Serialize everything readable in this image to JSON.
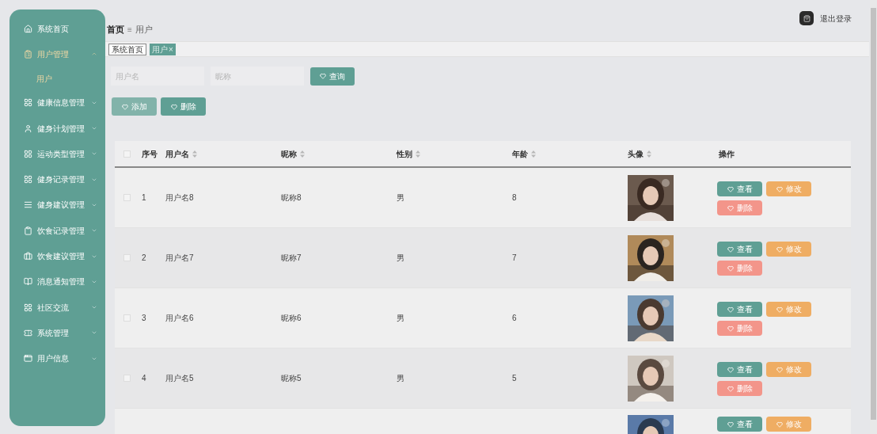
{
  "sidebar": {
    "items": [
      {
        "label": "系统首页",
        "selected": false
      },
      {
        "label": "用户管理",
        "selected": true,
        "expanded": true,
        "children": [
          {
            "label": "用户",
            "selected": true
          }
        ]
      },
      {
        "label": "健康信息管理",
        "selected": false,
        "expanded": false
      },
      {
        "label": "健身计划管理",
        "selected": false,
        "expanded": false
      },
      {
        "label": "运动类型管理",
        "selected": false,
        "expanded": false
      },
      {
        "label": "健身记录管理",
        "selected": false,
        "expanded": false
      },
      {
        "label": "健身建议管理",
        "selected": false,
        "expanded": false
      },
      {
        "label": "饮食记录管理",
        "selected": false,
        "expanded": false
      },
      {
        "label": "饮食建议管理",
        "selected": false,
        "expanded": false
      },
      {
        "label": "消息通知管理",
        "selected": false,
        "expanded": false
      },
      {
        "label": "社区交流",
        "selected": false,
        "expanded": false
      },
      {
        "label": "系统管理",
        "selected": false,
        "expanded": false
      },
      {
        "label": "用户信息",
        "selected": false,
        "expanded": false
      }
    ]
  },
  "header": {
    "breadcrumb": [
      "首页",
      "用户"
    ],
    "separator": "≡",
    "logout": "退出登录"
  },
  "tabs": [
    {
      "label": "系统首页",
      "selected": false
    },
    {
      "label": "用户",
      "selected": true,
      "close": "×"
    }
  ],
  "search": {
    "fields": [
      {
        "placeholder": "用户名"
      },
      {
        "placeholder": "昵称"
      }
    ],
    "button": "查询"
  },
  "toolbar": [
    {
      "label": "添加",
      "disabled": true
    },
    {
      "label": "删除",
      "disabled": false
    }
  ],
  "table": {
    "select_all": {
      "checked": false
    },
    "columns": [
      {
        "label": "序号",
        "sortable": false
      },
      {
        "label": "用户名",
        "sortable": true
      },
      {
        "label": "昵称",
        "sortable": true
      },
      {
        "label": "性别",
        "sortable": true
      },
      {
        "label": "年龄",
        "sortable": true
      },
      {
        "label": "头像",
        "sortable": true
      },
      {
        "label": "操作",
        "sortable": false
      }
    ],
    "rows": [
      {
        "checked": false,
        "cells": [
          "1",
          "用户名8",
          "昵称8",
          "男",
          "8"
        ],
        "avatar": {
          "kind": "picture"
        },
        "actions": [
          {
            "kind": "view",
            "label": "查看"
          },
          {
            "kind": "edit",
            "label": "修改"
          },
          {
            "kind": "delete",
            "label": "删除"
          }
        ]
      },
      {
        "checked": false,
        "cells": [
          "2",
          "用户名7",
          "昵称7",
          "男",
          "7"
        ],
        "avatar": {
          "kind": "picture"
        },
        "actions": [
          {
            "kind": "view",
            "label": "查看"
          },
          {
            "kind": "edit",
            "label": "修改"
          },
          {
            "kind": "delete",
            "label": "删除"
          }
        ]
      },
      {
        "checked": false,
        "cells": [
          "3",
          "用户名6",
          "昵称6",
          "男",
          "6"
        ],
        "avatar": {
          "kind": "picture"
        },
        "actions": [
          {
            "kind": "view",
            "label": "查看"
          },
          {
            "kind": "edit",
            "label": "修改"
          },
          {
            "kind": "delete",
            "label": "删除"
          }
        ]
      },
      {
        "checked": false,
        "cells": [
          "4",
          "用户名5",
          "昵称5",
          "男",
          "5"
        ],
        "avatar": {
          "kind": "picture"
        },
        "actions": [
          {
            "kind": "view",
            "label": "查看"
          },
          {
            "kind": "edit",
            "label": "修改"
          },
          {
            "kind": "delete",
            "label": "删除"
          }
        ]
      },
      {
        "avatar": {
          "kind": "picture"
        },
        "actions": [
          {
            "kind": "view",
            "label": "查看"
          },
          {
            "kind": "edit",
            "label": "修改"
          }
        ]
      }
    ]
  }
}
